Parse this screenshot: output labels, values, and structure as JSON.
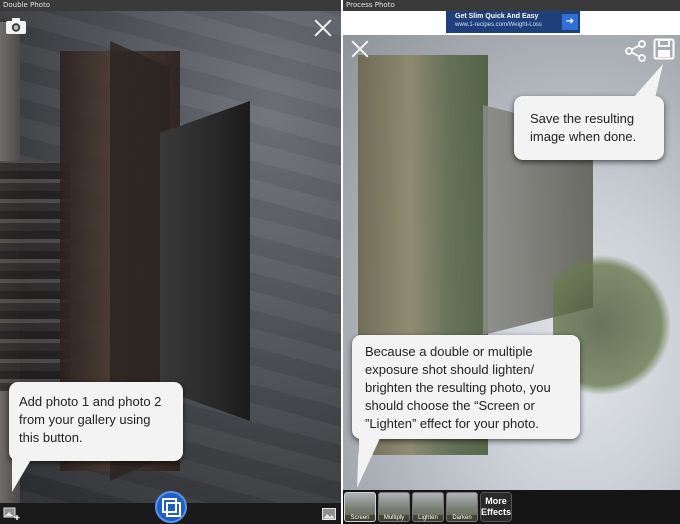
{
  "left_panel": {
    "title": "Double Photo",
    "callout": "Add photo 1 and photo 2 from your gallery using this button.",
    "icons": [
      "camera-switch-icon",
      "close-icon",
      "add-gallery-icon",
      "combine-layers-icon",
      "gallery-icon"
    ]
  },
  "right_panel": {
    "title": "Process Photo",
    "ad": {
      "title": "Get Slim Quick And Easy",
      "subtitle": "www.1-recipes.com/Weight-Loss",
      "arrow": "➔"
    },
    "save_callout": "Save the resulting image when done.",
    "effect_callout": "Because a double or multiple exposure shot should lighten/ brighten the resulting photo, you should choose the “Screen or ”Lighten” effect for your photo.",
    "effects": [
      {
        "label": "Screen"
      },
      {
        "label": "Multiply"
      },
      {
        "label": "Lighten"
      },
      {
        "label": "Darken"
      }
    ],
    "more_effects": "More Effects",
    "icons": [
      "close-icon",
      "share-icon",
      "save-icon"
    ]
  },
  "colors": {
    "bar_bg": "#1a1a1a",
    "callout_bg": "#f3f3f3",
    "accent_blue": "#1e5fc7",
    "ad_bg": "#1f3f7a"
  }
}
